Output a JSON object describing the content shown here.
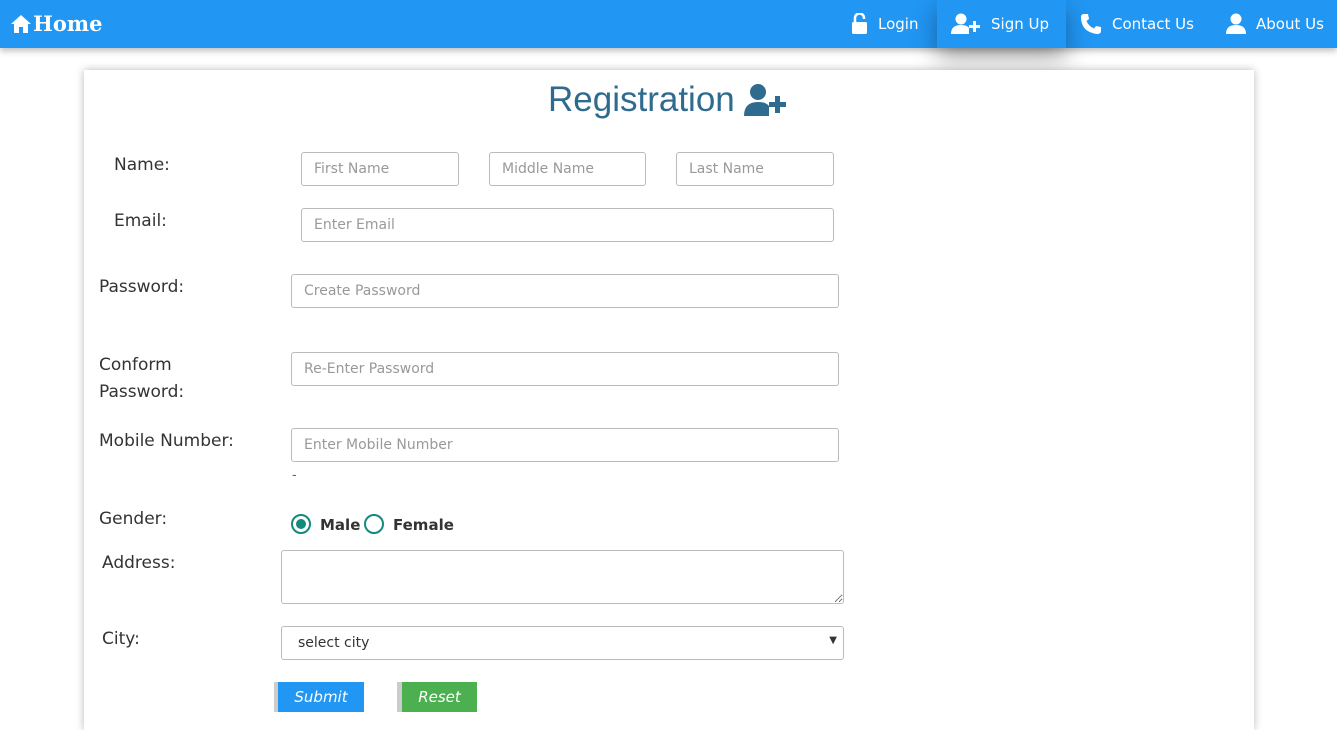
{
  "nav": {
    "home_label": "Home",
    "items": [
      {
        "label": "Login",
        "icon": "unlock-icon"
      },
      {
        "label": "Sign Up",
        "icon": "user-plus-icon"
      },
      {
        "label": "Contact Us",
        "icon": "phone-icon"
      },
      {
        "label": "About Us",
        "icon": "user-icon"
      }
    ],
    "active_item": "Sign Up",
    "bar_color": "#2196f3"
  },
  "form": {
    "title": "Registration",
    "name": {
      "label": "Name:",
      "first_placeholder": "First Name",
      "middle_placeholder": "Middle Name",
      "last_placeholder": "Last Name"
    },
    "email": {
      "label": "Email:",
      "placeholder": "Enter Email"
    },
    "password": {
      "label": "Password:",
      "placeholder": "Create Password"
    },
    "confirm_password": {
      "label_line1": "Conform",
      "label_line2": "Password:",
      "placeholder": "Re-Enter Password"
    },
    "mobile": {
      "label": "Mobile Number:",
      "placeholder": "Enter Mobile Number",
      "validation_mark": "-"
    },
    "gender": {
      "label": "Gender:",
      "options": [
        "Male",
        "Female"
      ],
      "selected": "Male"
    },
    "address": {
      "label": "Address:",
      "value": ""
    },
    "city": {
      "label": "City:",
      "selected": "select city"
    },
    "buttons": {
      "submit": "Submit",
      "reset": "Reset"
    }
  },
  "colors": {
    "title": "#2e6b8f",
    "radio": "#138a7e",
    "submit": "#2196f3",
    "reset": "#4caf50"
  }
}
